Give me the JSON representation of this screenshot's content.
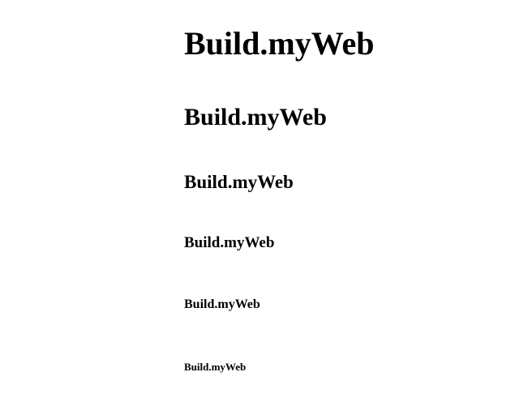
{
  "headings": [
    {
      "level": 1,
      "text": "Build.myWeb"
    },
    {
      "level": 2,
      "text": "Build.myWeb"
    },
    {
      "level": 3,
      "text": "Build.myWeb"
    },
    {
      "level": 4,
      "text": "Build.myWeb"
    },
    {
      "level": 5,
      "text": "Build.myWeb"
    },
    {
      "level": 6,
      "text": "Build.myWeb"
    }
  ],
  "colors": {
    "background": "#ffffff",
    "text": "#000000"
  }
}
